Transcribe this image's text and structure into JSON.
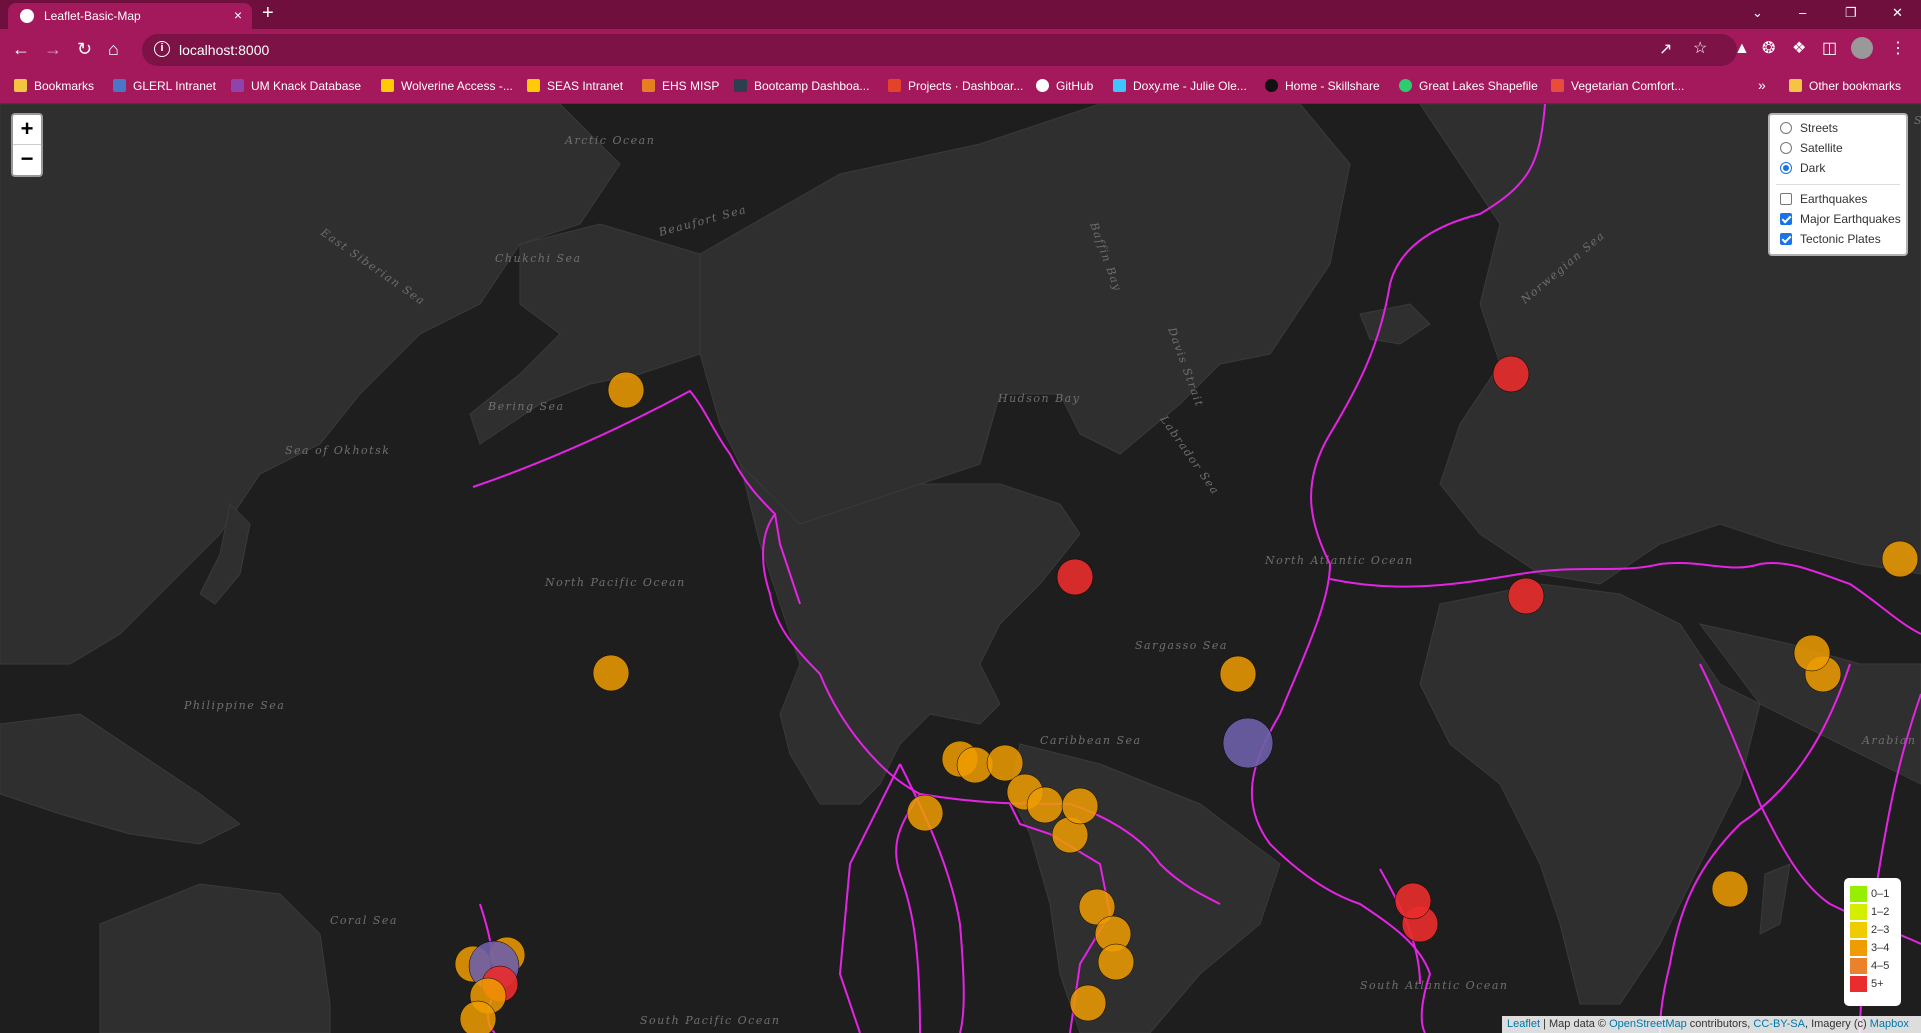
{
  "browser": {
    "tab_title": "Leaflet-Basic-Map",
    "tab_close": "×",
    "new_tab": "+",
    "url": "localhost:8000",
    "info_icon": "i",
    "window_controls": [
      "⌄",
      "–",
      "❐",
      "✕"
    ],
    "bookmarks": [
      {
        "label": "Bookmarks",
        "icon": "folder-icon",
        "color": "#f4c542"
      },
      {
        "label": "GLERL Intranet",
        "icon": "glerl-icon",
        "color": "#4a76c7"
      },
      {
        "label": "UM Knack Database",
        "icon": "knack-icon",
        "color": "#8e44ad"
      },
      {
        "label": "Wolverine Access -...",
        "icon": "umich-icon",
        "color": "#ffcb05"
      },
      {
        "label": "SEAS Intranet",
        "icon": "umich-icon",
        "color": "#ffcb05"
      },
      {
        "label": "EHS MISP",
        "icon": "ehs-icon",
        "color": "#e67e22"
      },
      {
        "label": "Bootcamp Dashboa...",
        "icon": "bootcamp-icon",
        "color": "#2c3e50"
      },
      {
        "label": "Projects · Dashboar...",
        "icon": "gitlab-icon",
        "color": "#e24329"
      },
      {
        "label": "GitHub",
        "icon": "github-icon",
        "color": "#ffffff"
      },
      {
        "label": "Doxy.me - Julie Ole...",
        "icon": "doxy-icon",
        "color": "#40c4ff"
      },
      {
        "label": "Home - Skillshare",
        "icon": "skillshare-icon",
        "color": "#111111"
      },
      {
        "label": "Great Lakes Shapefile",
        "icon": "shapefile-icon",
        "color": "#2ecc71"
      },
      {
        "label": "Vegetarian Comfort...",
        "icon": "nyt-icon",
        "color": "#e74c3c"
      }
    ],
    "bookmarks_more": "»",
    "other_bookmarks": "Other bookmarks"
  },
  "map": {
    "zoom_in": "+",
    "zoom_out": "−",
    "base_layers": [
      {
        "label": "Streets",
        "selected": false
      },
      {
        "label": "Satellite",
        "selected": false
      },
      {
        "label": "Dark",
        "selected": true
      }
    ],
    "overlays": [
      {
        "label": "Earthquakes",
        "checked": false
      },
      {
        "label": "Major Earthquakes",
        "checked": true
      },
      {
        "label": "Tectonic Plates",
        "checked": true
      }
    ],
    "legend": [
      {
        "label": "0–1",
        "color": "#98ee00"
      },
      {
        "label": "1–2",
        "color": "#d4ee00"
      },
      {
        "label": "2–3",
        "color": "#eecc00"
      },
      {
        "label": "3–4",
        "color": "#ee9c00"
      },
      {
        "label": "4–5",
        "color": "#ea822c"
      },
      {
        "label": "5+",
        "color": "#ea2c2c"
      }
    ],
    "attribution": {
      "leaflet": "Leaflet",
      "text1": " | Map data © ",
      "osm": "OpenStreetMap",
      "text2": " contributors, ",
      "license": "CC-BY-SA",
      "text3": ", Imagery (c) ",
      "mapbox": "Mapbox"
    },
    "labels": [
      "Arctic Ocean",
      "East Siberian Sea",
      "Beaufort Sea",
      "Chukchi Sea",
      "Bering Sea",
      "Sea of Okhotsk",
      "North Pacific Ocean",
      "Philippine Sea",
      "Coral Sea",
      "South Pacific Ocean",
      "Hudson Bay",
      "Labrador Sea",
      "Davis Strait",
      "Baffin Bay",
      "North Atlantic Ocean",
      "Sargasso Sea",
      "Caribbean Sea",
      "South Atlantic Ocean",
      "Norwegian Sea",
      "Barents Sea",
      "Arabian Sea"
    ]
  }
}
